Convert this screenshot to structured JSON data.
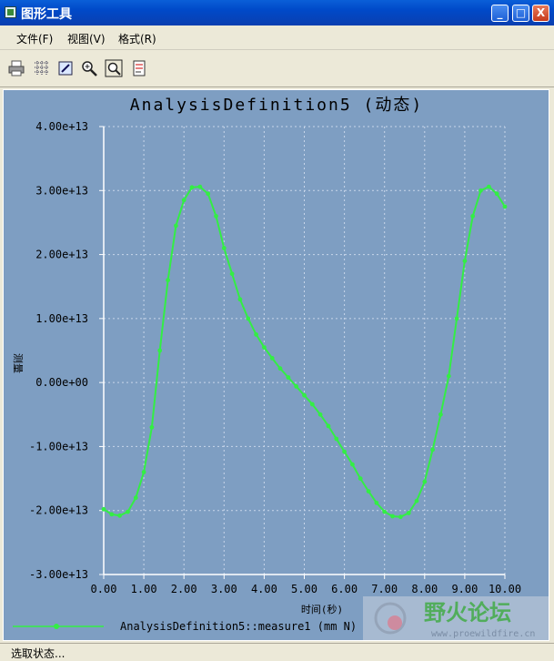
{
  "window": {
    "title": "图形工具",
    "controls": [
      "_",
      "□",
      "X"
    ]
  },
  "menu": {
    "items": [
      {
        "label": "文件(F)"
      },
      {
        "label": "视图(V)"
      },
      {
        "label": "格式(R)"
      }
    ]
  },
  "toolbar": {
    "icons": [
      "print-icon",
      "grid-icon",
      "edit-icon",
      "zoom-in-icon",
      "zoom-fit-icon",
      "export-icon"
    ]
  },
  "chart_data": {
    "type": "line",
    "title": "AnalysisDefinition5 (动态)",
    "xlabel": "时间(秒)",
    "ylabel": "测量",
    "xlim": [
      0,
      10
    ],
    "ylim": [
      -30000000000000.0,
      40000000000000.0
    ],
    "xticks": [
      "0.00",
      "1.00",
      "2.00",
      "3.00",
      "4.00",
      "5.00",
      "6.00",
      "7.00",
      "8.00",
      "9.00",
      "10.00"
    ],
    "yticks": [
      "4.00e+13",
      "3.00e+13",
      "2.00e+13",
      "1.00e+13",
      "0.00e+00",
      "-1.00e+13",
      "-2.00e+13",
      "-3.00e+13"
    ],
    "grid": true,
    "legend_position": "bottom-left",
    "line_color": "#33ee44",
    "series": [
      {
        "name": "AnalysisDefinition5::measure1 (mm N)",
        "x": [
          0.0,
          0.2,
          0.4,
          0.6,
          0.8,
          1.0,
          1.2,
          1.4,
          1.6,
          1.8,
          2.0,
          2.2,
          2.4,
          2.6,
          2.8,
          3.0,
          3.2,
          3.4,
          3.6,
          3.8,
          4.0,
          4.2,
          4.4,
          4.6,
          4.8,
          5.0,
          5.2,
          5.4,
          5.6,
          5.8,
          6.0,
          6.2,
          6.4,
          6.6,
          6.8,
          7.0,
          7.2,
          7.4,
          7.6,
          7.8,
          8.0,
          8.2,
          8.4,
          8.6,
          8.8,
          9.0,
          9.2,
          9.4,
          9.6,
          9.8,
          10.0
        ],
        "y": [
          -19800000000000.0,
          -20600000000000.0,
          -20800000000000.0,
          -20200000000000.0,
          -18000000000000.0,
          -14000000000000.0,
          -7000000000000.0,
          5000000000000.0,
          16000000000000.0,
          24500000000000.0,
          28500000000000.0,
          30500000000000.0,
          30600000000000.0,
          29500000000000.0,
          26000000000000.0,
          21000000000000.0,
          17000000000000.0,
          13000000000000.0,
          10000000000000.0,
          7500000000000.0,
          5500000000000.0,
          3800000000000.0,
          2200000000000.0,
          800000000000.0,
          -600000000000.0,
          -2000000000000.0,
          -3400000000000.0,
          -5000000000000.0,
          -6800000000000.0,
          -8800000000000.0,
          -10800000000000.0,
          -12800000000000.0,
          -15000000000000.0,
          -17000000000000.0,
          -18800000000000.0,
          -20200000000000.0,
          -20900000000000.0,
          -21000000000000.0,
          -20400000000000.0,
          -18500000000000.0,
          -15500000000000.0,
          -10500000000000.0,
          -5000000000000.0,
          1000000000000.0,
          10000000000000.0,
          19000000000000.0,
          26000000000000.0,
          30000000000000.0,
          30600000000000.0,
          29500000000000.0,
          27500000000000.0
        ]
      }
    ]
  },
  "watermark": {
    "text": "野火论坛",
    "url": "www.proewildfire.cn"
  },
  "status": {
    "text": "选取状态..."
  }
}
